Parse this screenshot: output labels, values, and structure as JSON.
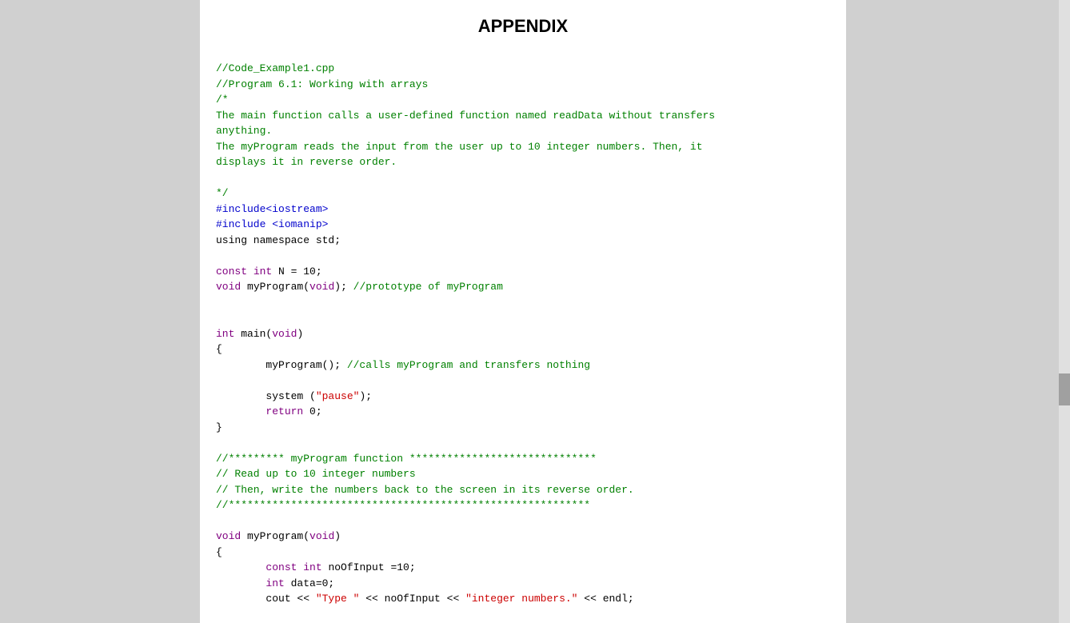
{
  "page": {
    "title": "APPENDIX",
    "background": "#d0d0d0",
    "content_bg": "#ffffff"
  },
  "code": {
    "lines": [
      {
        "id": 1,
        "type": "comment",
        "text": "//Code_Example1.cpp"
      },
      {
        "id": 2,
        "type": "comment",
        "text": "//Program 6.1: Working with arrays"
      },
      {
        "id": 3,
        "type": "comment",
        "text": "/*"
      },
      {
        "id": 4,
        "type": "comment_text",
        "text": "The main function calls a user-defined function named readData without transfers"
      },
      {
        "id": 5,
        "type": "comment_text",
        "text": "anything."
      },
      {
        "id": 6,
        "type": "comment_text",
        "text": "The myProgram reads the input from the user up to 10 integer numbers. Then, it"
      },
      {
        "id": 7,
        "type": "comment_text",
        "text": "displays it in reverse order."
      },
      {
        "id": 8,
        "type": "empty"
      },
      {
        "id": 9,
        "type": "comment",
        "text": "*/"
      },
      {
        "id": 10,
        "type": "preprocessor",
        "text": "#include<iostream>"
      },
      {
        "id": 11,
        "type": "preprocessor",
        "text": "#include <iomanip>"
      },
      {
        "id": 12,
        "type": "normal",
        "text": "using namespace std;"
      },
      {
        "id": 13,
        "type": "empty"
      },
      {
        "id": 14,
        "type": "mixed_const_int",
        "text": "const int N = 10;"
      },
      {
        "id": 15,
        "type": "mixed_void_prototype",
        "text": "void myProgram(void); //prototype of myProgram"
      },
      {
        "id": 16,
        "type": "empty"
      },
      {
        "id": 17,
        "type": "empty"
      },
      {
        "id": 18,
        "type": "int_main",
        "text": "int main(void)"
      },
      {
        "id": 19,
        "type": "normal",
        "text": "{"
      },
      {
        "id": 20,
        "type": "call_comment",
        "text": "        myProgram(); //calls myProgram and transfers nothing"
      },
      {
        "id": 21,
        "type": "empty"
      },
      {
        "id": 22,
        "type": "system_call",
        "text": "        system (\"pause\");"
      },
      {
        "id": 23,
        "type": "return_line",
        "text": "        return 0;"
      },
      {
        "id": 24,
        "type": "normal",
        "text": "}"
      },
      {
        "id": 25,
        "type": "empty"
      },
      {
        "id": 26,
        "type": "comment",
        "text": "//********* myProgram function ******************************"
      },
      {
        "id": 27,
        "type": "comment",
        "text": "// Read up to 10 integer numbers"
      },
      {
        "id": 28,
        "type": "comment",
        "text": "// Then, write the numbers back to the screen in its reverse order."
      },
      {
        "id": 29,
        "type": "comment",
        "text": "//**********************************************************"
      },
      {
        "id": 30,
        "type": "empty"
      },
      {
        "id": 31,
        "type": "void_myprogram",
        "text": "void myProgram(void)"
      },
      {
        "id": 32,
        "type": "normal",
        "text": "{"
      },
      {
        "id": 33,
        "type": "const_int_noOfInput",
        "text": "        const int noOfInput =10;"
      },
      {
        "id": 34,
        "type": "int_data",
        "text": "        int data=0;"
      },
      {
        "id": 35,
        "type": "cout_line",
        "text": "        cout << \"Type \" << noOfInput << \"integer numbers.\" << endl;"
      }
    ]
  }
}
